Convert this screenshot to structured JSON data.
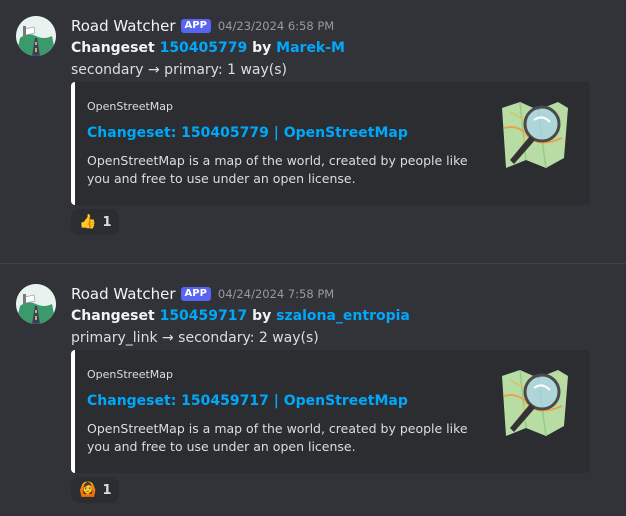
{
  "messages": [
    {
      "author": "Road Watcher",
      "badge": "APP",
      "timestamp": "04/23/2024 6:58 PM",
      "changeset_prefix": "Changeset ",
      "changeset_id": "150405779",
      "by": " by ",
      "user": "Marek-M",
      "summary": "secondary → primary: 1 way(s)",
      "embed": {
        "provider": "OpenStreetMap",
        "title": "Changeset: 150405779 | OpenStreetMap",
        "description": "OpenStreetMap is a map of the world, created by people like you and free to use under an open license.",
        "accent_color": "#ffffff"
      },
      "reaction": {
        "emoji": "👍",
        "count": "1"
      }
    },
    {
      "author": "Road Watcher",
      "badge": "APP",
      "timestamp": "04/24/2024 7:58 PM",
      "changeset_prefix": "Changeset ",
      "changeset_id": "150459717",
      "by": " by ",
      "user": "szalona_entropia",
      "summary": "primary_link → secondary: 2 way(s)",
      "embed": {
        "provider": "OpenStreetMap",
        "title": "Changeset: 150459717 | OpenStreetMap",
        "description": "OpenStreetMap is a map of the world, created by people like you and free to use under an open license.",
        "accent_color": "#ffffff"
      },
      "reaction": {
        "emoji": "🙆",
        "count": "1"
      }
    }
  ],
  "colors": {
    "background": "#313338",
    "link": "#00a8fc",
    "badge": "#5865f2",
    "embed_bg": "#2b2d31"
  },
  "icons": {
    "avatar": "road-avatar-icon",
    "thumbnail": "osm-magnifier-icon"
  }
}
